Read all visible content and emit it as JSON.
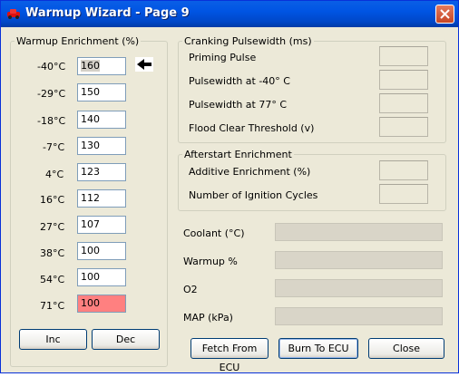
{
  "window": {
    "title": "Warmup Wizard - Page 9"
  },
  "warmup": {
    "legend": "Warmup Enrichment (%)",
    "rows": [
      {
        "temp": "-40°C",
        "value": "160"
      },
      {
        "temp": "-29°C",
        "value": "150"
      },
      {
        "temp": "-18°C",
        "value": "140"
      },
      {
        "temp": "-7°C",
        "value": "130"
      },
      {
        "temp": "4°C",
        "value": "123"
      },
      {
        "temp": "16°C",
        "value": "112"
      },
      {
        "temp": "27°C",
        "value": "107"
      },
      {
        "temp": "38°C",
        "value": "100"
      },
      {
        "temp": "54°C",
        "value": "100"
      },
      {
        "temp": "71°C",
        "value": "100"
      }
    ],
    "inc_label": "Inc",
    "dec_label": "Dec"
  },
  "cranking": {
    "legend": "Cranking Pulsewidth (ms)",
    "priming": "Priming Pulse",
    "pw_minus40": "Pulsewidth at -40° C",
    "pw_77": "Pulsewidth at  77° C",
    "flood": "Flood Clear Threshold (v)"
  },
  "afterstart": {
    "legend": "Afterstart Enrichment",
    "additive": "Additive Enrichment (%)",
    "cycles": "Number of Ignition Cycles"
  },
  "sensors": {
    "coolant": "Coolant (°C)",
    "warmup": "Warmup %",
    "o2": "O2",
    "map": "MAP (kPa)"
  },
  "buttons": {
    "fetch": "Fetch From ECU",
    "burn": "Burn To ECU",
    "close": "Close"
  },
  "colors": {
    "title_bar": "#0054e3",
    "highlight_cell": "#ff8080",
    "dialog_bg": "#ece9d8"
  }
}
